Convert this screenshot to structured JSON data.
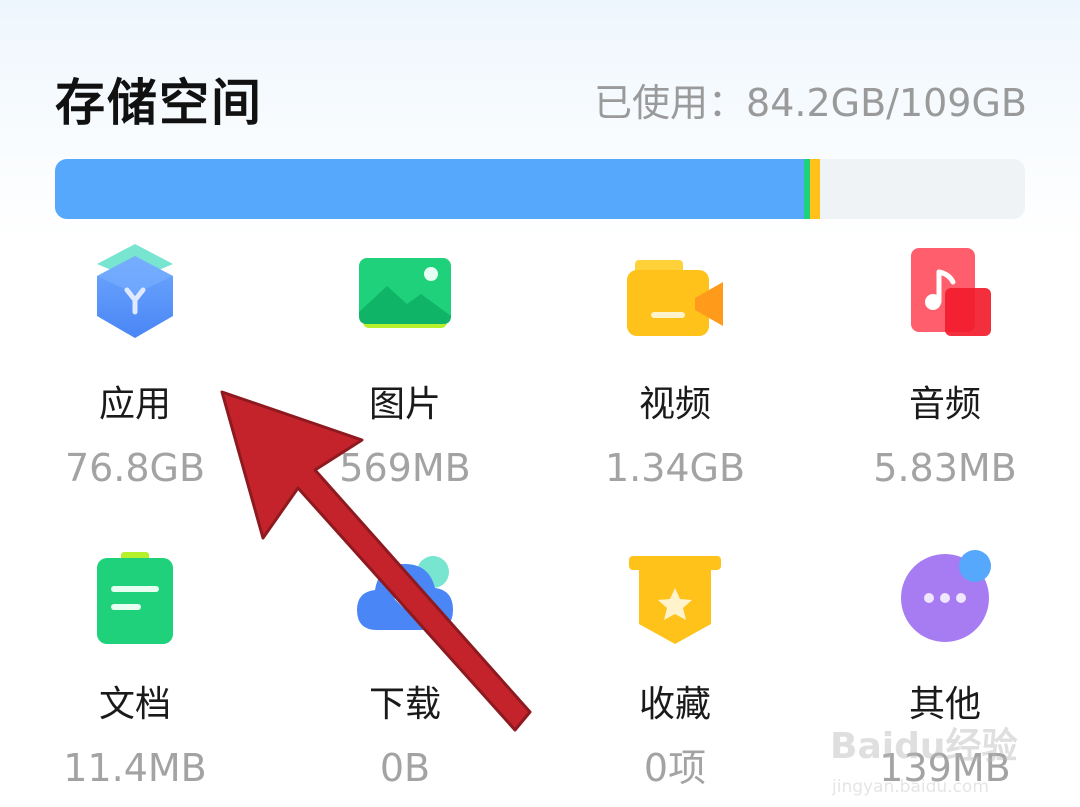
{
  "storage": {
    "title": "存储空间",
    "usage_label": "已使用：84.2GB/109GB",
    "used_fraction": 0.772
  },
  "colors": {
    "apps": "#55a8fb",
    "accent_green": "#1fd17a",
    "accent_yellow": "#ffc21a",
    "track": "#f0f3f5",
    "arrow": "#c4232b"
  },
  "categories": [
    {
      "name": "应用",
      "size": "76.8GB",
      "icon": "apps-cube-icon"
    },
    {
      "name": "图片",
      "size": "569MB",
      "icon": "image-icon"
    },
    {
      "name": "视频",
      "size": "1.34GB",
      "icon": "video-icon"
    },
    {
      "name": "音频",
      "size": "5.83MB",
      "icon": "music-icon"
    },
    {
      "name": "文档",
      "size": "11.4MB",
      "icon": "document-icon"
    },
    {
      "name": "下载",
      "size": "0B",
      "icon": "cloud-download-icon"
    },
    {
      "name": "收藏",
      "size": "0项",
      "icon": "star-badge-icon"
    },
    {
      "name": "其他",
      "size": "139MB",
      "icon": "more-dots-icon"
    }
  ],
  "watermark": {
    "text": "Baidu经验",
    "sub": "jingyan.baidu.com"
  }
}
